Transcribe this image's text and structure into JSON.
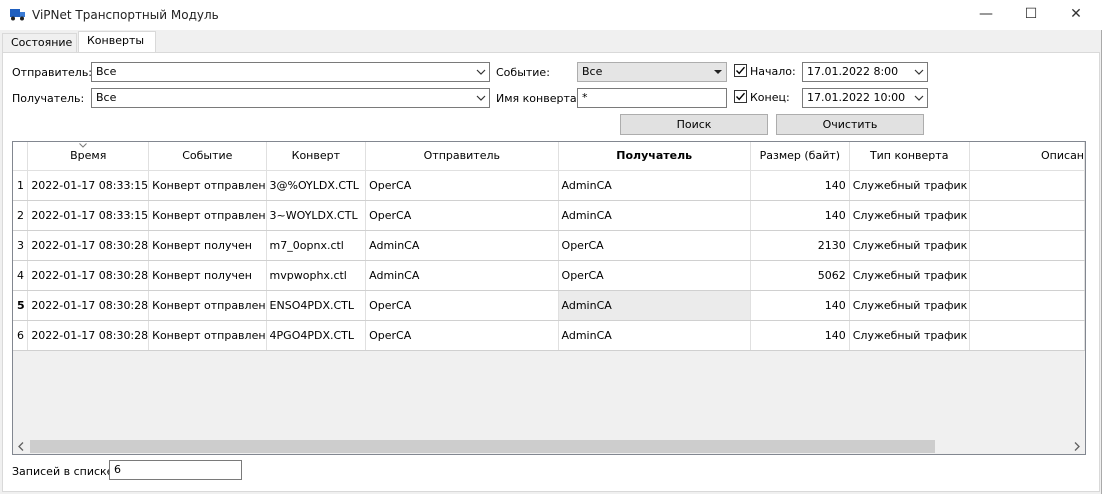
{
  "window": {
    "title": "ViPNet Транспортный Модуль",
    "minimize": "—",
    "maximize": "☐",
    "close": "✕"
  },
  "tabs": [
    {
      "label": "Состояние",
      "active": false
    },
    {
      "label": "Конверты",
      "active": true
    }
  ],
  "filters": {
    "sender_label": "Отправитель:",
    "sender_value": "Все",
    "recipient_label": "Получатель:",
    "recipient_value": "Все",
    "event_label": "Событие:",
    "event_value": "Все",
    "envelope_name_label": "Имя конверта:",
    "envelope_name_value": "*",
    "start_label": "Начало:",
    "start_checked": true,
    "start_value": "17.01.2022 8:00",
    "end_label": "Конец:",
    "end_checked": true,
    "end_value": "17.01.2022 10:00",
    "search_button": "Поиск",
    "clear_button": "Очистить"
  },
  "table": {
    "columns": [
      "Время",
      "Событие",
      "Конверт",
      "Отправитель",
      "Получатель",
      "Размер (байт)",
      "Тип конверта",
      "Описан"
    ],
    "sorted_column": "Время",
    "bold_column": "Получатель",
    "rows": [
      {
        "n": "1",
        "time": "2022-01-17 08:33:15",
        "event": "Конверт отправлен",
        "envelope": "3@%OYLDX.CTL",
        "sender": "OperCA",
        "recipient": "AdminCA",
        "size": "140",
        "type": "Служебный трафик"
      },
      {
        "n": "2",
        "time": "2022-01-17 08:33:15",
        "event": "Конверт отправлен",
        "envelope": "3~WOYLDX.CTL",
        "sender": "OperCA",
        "recipient": "AdminCA",
        "size": "140",
        "type": "Служебный трафик"
      },
      {
        "n": "3",
        "time": "2022-01-17 08:30:28",
        "event": "Конверт получен",
        "envelope": "m7_0opnx.ctl",
        "sender": "AdminCA",
        "recipient": "OperCA",
        "size": "2130",
        "type": "Служебный трафик"
      },
      {
        "n": "4",
        "time": "2022-01-17 08:30:28",
        "event": "Конверт получен",
        "envelope": "mvpwophx.ctl",
        "sender": "AdminCA",
        "recipient": "OperCA",
        "size": "5062",
        "type": "Служебный трафик"
      },
      {
        "n": "5",
        "time": "2022-01-17 08:30:28",
        "event": "Конверт отправлен",
        "envelope": "ENSO4PDX.CTL",
        "sender": "OperCA",
        "recipient": "AdminCA",
        "size": "140",
        "type": "Служебный трафик"
      },
      {
        "n": "6",
        "time": "2022-01-17 08:30:28",
        "event": "Конверт отправлен",
        "envelope": "4PGO4PDX.CTL",
        "sender": "OperCA",
        "recipient": "AdminCA",
        "size": "140",
        "type": "Служебный трафик"
      }
    ],
    "current_row": "5"
  },
  "footer": {
    "count_label": "Записей в списке:",
    "count_value": "6"
  },
  "colors": {
    "window_bg": "#f0f0f0",
    "grid_line": "#e0e0e0",
    "selected_cell": "#ebebeb"
  }
}
